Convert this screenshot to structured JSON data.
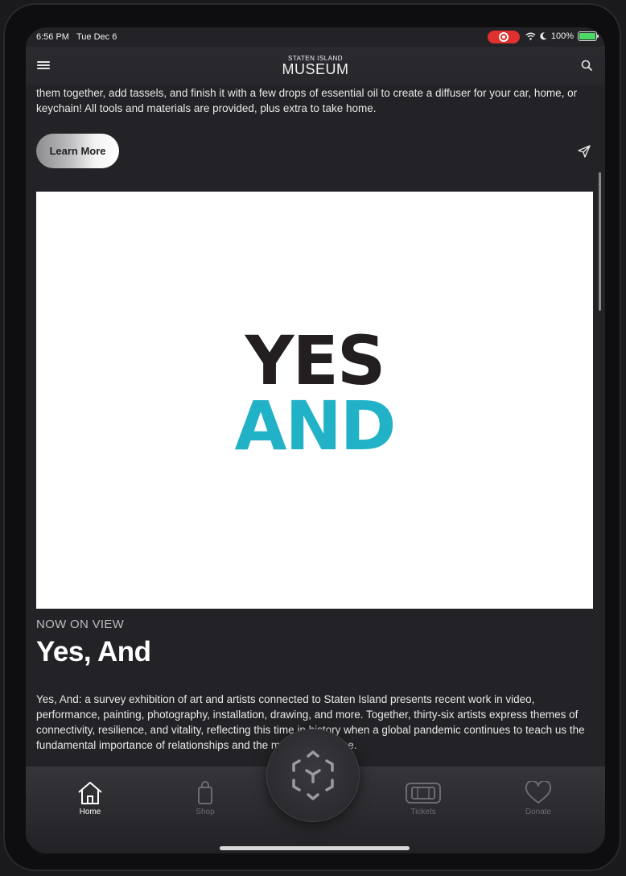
{
  "status_bar": {
    "time": "6:56 PM",
    "date": "Tue Dec 6",
    "battery": "100%"
  },
  "header": {
    "logo_top": "STATEN ISLAND",
    "logo_main": "MUSEUM"
  },
  "intro": {
    "text": "them together, add tassels, and finish it with a few drops of essential oil to create a diffuser for your car, home, or keychain! All tools and materials are provided, plus extra to take home.",
    "button_label": "Learn More"
  },
  "feature": {
    "image_line1": "YES",
    "image_line2": "AND",
    "eyebrow": "NOW ON VIEW",
    "title": "Yes, And",
    "description": "Yes, And: a survey exhibition of art and artists connected to Staten Island presents recent work in video, performance, painting, photography, installation, drawing, and more. Together, thirty-six artists express themes of connectivity, resilience, and vitality, reflecting this time in history when a global pandemic continues to teach us the fundamental importance of relationships and the meaning of place."
  },
  "tabs": [
    {
      "label": "Home",
      "icon": "home-icon",
      "active": true
    },
    {
      "label": "Shop",
      "icon": "bag-icon",
      "active": false
    },
    {
      "label": "Tickets",
      "icon": "ticket-icon",
      "active": false
    },
    {
      "label": "Donate",
      "icon": "heart-icon",
      "active": false
    }
  ],
  "colors": {
    "accent_teal": "#22b2c8",
    "recording_red": "#e0302f",
    "background": "#232226"
  }
}
